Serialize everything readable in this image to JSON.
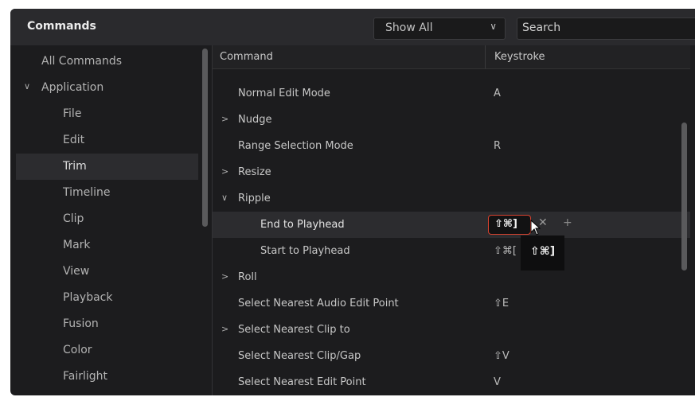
{
  "header": {
    "title": "Commands",
    "filter_value": "Show All",
    "search_placeholder": "Search"
  },
  "sidebar": {
    "items": [
      {
        "label": "All Commands"
      },
      {
        "label": "Application"
      },
      {
        "label": "File"
      },
      {
        "label": "Edit"
      },
      {
        "label": "Trim"
      },
      {
        "label": "Timeline"
      },
      {
        "label": "Clip"
      },
      {
        "label": "Mark"
      },
      {
        "label": "View"
      },
      {
        "label": "Playback"
      },
      {
        "label": "Fusion"
      },
      {
        "label": "Color"
      },
      {
        "label": "Fairlight"
      }
    ]
  },
  "table": {
    "headers": {
      "command": "Command",
      "keystroke": "Keystroke"
    },
    "rows": [
      {
        "command": "Normal Edit Mode",
        "keystroke": "A"
      },
      {
        "command": "Nudge",
        "keystroke": ""
      },
      {
        "command": "Range Selection Mode",
        "keystroke": "R"
      },
      {
        "command": "Resize",
        "keystroke": ""
      },
      {
        "command": "Ripple",
        "keystroke": ""
      },
      {
        "command": "End to Playhead",
        "keystroke": "⇧⌘]"
      },
      {
        "command": "Start to Playhead",
        "keystroke": "⇧⌘["
      },
      {
        "command": "Roll",
        "keystroke": ""
      },
      {
        "command": "Select Nearest Audio Edit Point",
        "keystroke": "⇧E"
      },
      {
        "command": "Select Nearest Clip to",
        "keystroke": ""
      },
      {
        "command": "Select Nearest Clip/Gap",
        "keystroke": "⇧V"
      },
      {
        "command": "Select Nearest Edit Point",
        "keystroke": "V"
      }
    ]
  },
  "tooltip": {
    "text": "⇧⌘]"
  },
  "icons": {
    "collapse": "chevron-right-icon",
    "expand": "chevron-down-icon",
    "remove": "close-icon",
    "add": "plus-icon",
    "cursor": "pointer-cursor-icon"
  }
}
